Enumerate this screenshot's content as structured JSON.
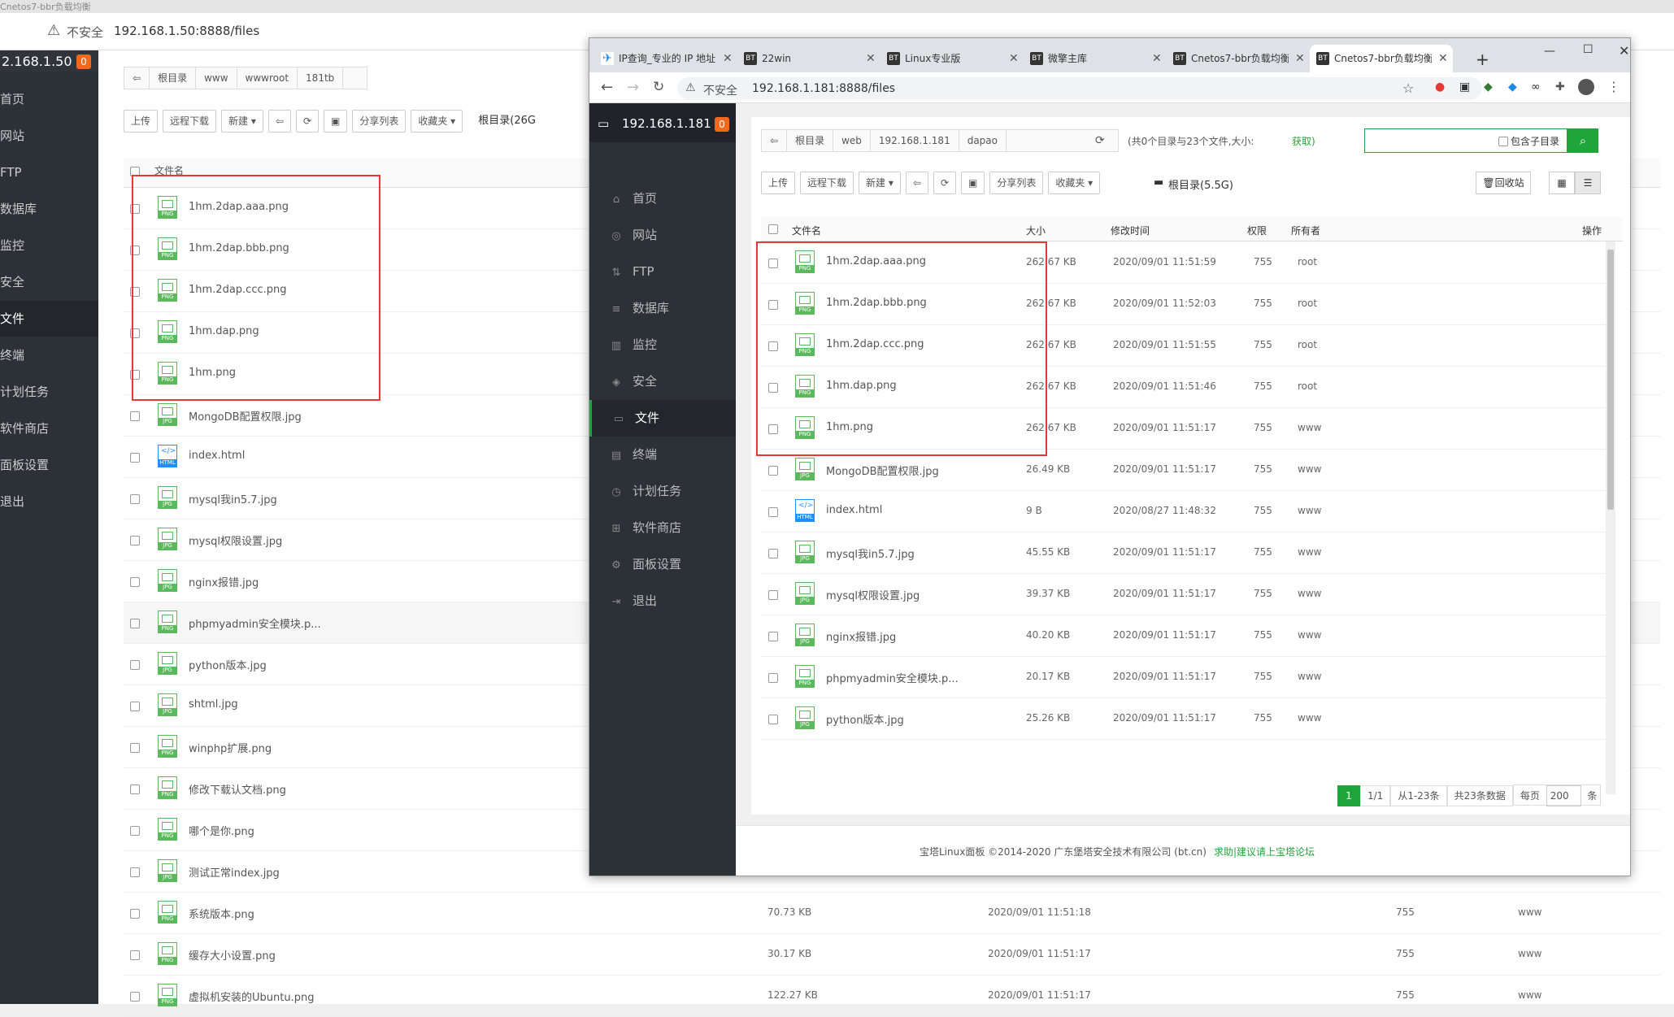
{
  "bg": {
    "title": "Cnetos7-bbr负载均衡",
    "addr_security": "不安全",
    "addr_url": "192.168.1.50:8888/files",
    "host": "2.168.1.50",
    "badge": "0",
    "nav": [
      "首页",
      "网站",
      "FTP",
      "数据库",
      "监控",
      "安全",
      "文件",
      "终端",
      "计划任务",
      "软件商店",
      "面板设置",
      "退出"
    ],
    "crumbs": [
      "根目录",
      "www",
      "wwwroot",
      "181tb"
    ],
    "toolbar": [
      "上传",
      "远程下载",
      "新建 ▾",
      "⇦",
      "⟳",
      "▣",
      "分享列表",
      "收藏夹 ▾"
    ],
    "root_label": "根目录(26G",
    "col_filename": "文件名",
    "files": [
      {
        "name": "1hm.2dap.aaa.png",
        "type": "PNG"
      },
      {
        "name": "1hm.2dap.bbb.png",
        "type": "PNG"
      },
      {
        "name": "1hm.2dap.ccc.png",
        "type": "PNG"
      },
      {
        "name": "1hm.dap.png",
        "type": "PNG"
      },
      {
        "name": "1hm.png",
        "type": "PNG"
      },
      {
        "name": "MongoDB配置权限.jpg",
        "type": "JPG"
      },
      {
        "name": "index.html",
        "type": "HTML"
      },
      {
        "name": "mysql我in5.7.jpg",
        "type": "JPG"
      },
      {
        "name": "mysql权限设置.jpg",
        "type": "JPG"
      },
      {
        "name": "nginx报错.jpg",
        "type": "JPG"
      },
      {
        "name": "phpmyadmin安全模块.p...",
        "type": "PNG"
      },
      {
        "name": "python版本.jpg",
        "type": "JPG"
      },
      {
        "name": "shtml.jpg",
        "type": "JPG"
      },
      {
        "name": "winphp扩展.png",
        "type": "PNG"
      },
      {
        "name": "修改下载认文档.png",
        "type": "PNG"
      },
      {
        "name": "哪个是你.png",
        "type": "PNG"
      },
      {
        "name": "测试正常index.jpg",
        "type": "JPG"
      },
      {
        "name": "系统版本.png",
        "type": "PNG",
        "size": "70.73 KB",
        "time": "2020/09/01 11:51:18",
        "perm": "755",
        "owner": "www"
      },
      {
        "name": "缓存大小设置.png",
        "type": "PNG",
        "size": "30.17 KB",
        "time": "2020/09/01 11:51:17",
        "perm": "755",
        "owner": "www"
      },
      {
        "name": "虚拟机安装的Ubuntu.png",
        "type": "PNG",
        "size": "122.27 KB",
        "time": "2020/09/01 11:51:17",
        "perm": "755",
        "owner": "www"
      }
    ]
  },
  "fw": {
    "tabs": [
      {
        "icon": "IP",
        "label": "IP查询_专业的 IP 地址"
      },
      {
        "icon": "BT",
        "label": "22win"
      },
      {
        "icon": "BT",
        "label": "Linux专业版"
      },
      {
        "icon": "BT",
        "label": "微擎主库"
      },
      {
        "icon": "BT",
        "label": "Cnetos7-bbr负载均衡"
      },
      {
        "icon": "BT",
        "label": "Cnetos7-bbr负载均衡"
      }
    ],
    "new_tab": "+",
    "addr_security": "不安全",
    "addr_url": "192.168.1.181:8888/files",
    "host": "192.168.1.181",
    "badge": "0",
    "nav": [
      {
        "icon": "⌂",
        "label": "首页"
      },
      {
        "icon": "◎",
        "label": "网站"
      },
      {
        "icon": "⇅",
        "label": "FTP"
      },
      {
        "icon": "≡",
        "label": "数据库"
      },
      {
        "icon": "▥",
        "label": "监控"
      },
      {
        "icon": "◈",
        "label": "安全"
      },
      {
        "icon": "▭",
        "label": "文件"
      },
      {
        "icon": "▤",
        "label": "终端"
      },
      {
        "icon": "◷",
        "label": "计划任务"
      },
      {
        "icon": "⊞",
        "label": "软件商店"
      },
      {
        "icon": "⚙",
        "label": "面板设置"
      },
      {
        "icon": "⇥",
        "label": "退出"
      }
    ],
    "crumbs": [
      "根目录",
      "web",
      "192.168.1.181",
      "dapao"
    ],
    "dir_info": "(共0个目录与23个文件,大小:",
    "dir_fetch": "获取)",
    "include_subdir": "包含子目录",
    "toolbar": [
      "上传",
      "远程下载",
      "新建 ▾",
      "⇦",
      "⟳",
      "▣",
      "分享列表",
      "收藏夹 ▾"
    ],
    "root_label": "根目录(5.5G)",
    "recycle": "回收站",
    "columns": [
      "文件名",
      "大小",
      "修改时间",
      "权限",
      "所有者",
      "操作"
    ],
    "files": [
      {
        "name": "1hm.2dap.aaa.png",
        "type": "PNG",
        "size": "262.67 KB",
        "time": "2020/09/01 11:51:59",
        "perm": "755",
        "owner": "root"
      },
      {
        "name": "1hm.2dap.bbb.png",
        "type": "PNG",
        "size": "262.67 KB",
        "time": "2020/09/01 11:52:03",
        "perm": "755",
        "owner": "root"
      },
      {
        "name": "1hm.2dap.ccc.png",
        "type": "PNG",
        "size": "262.67 KB",
        "time": "2020/09/01 11:51:55",
        "perm": "755",
        "owner": "root"
      },
      {
        "name": "1hm.dap.png",
        "type": "PNG",
        "size": "262.67 KB",
        "time": "2020/09/01 11:51:46",
        "perm": "755",
        "owner": "root"
      },
      {
        "name": "1hm.png",
        "type": "PNG",
        "size": "262.67 KB",
        "time": "2020/09/01 11:51:17",
        "perm": "755",
        "owner": "www"
      },
      {
        "name": "MongoDB配置权限.jpg",
        "type": "JPG",
        "size": "26.49 KB",
        "time": "2020/09/01 11:51:17",
        "perm": "755",
        "owner": "www"
      },
      {
        "name": "index.html",
        "type": "HTML",
        "size": "9 B",
        "time": "2020/08/27 11:48:32",
        "perm": "755",
        "owner": "www"
      },
      {
        "name": "mysql我in5.7.jpg",
        "type": "JPG",
        "size": "45.55 KB",
        "time": "2020/09/01 11:51:17",
        "perm": "755",
        "owner": "www"
      },
      {
        "name": "mysql权限设置.jpg",
        "type": "JPG",
        "size": "39.37 KB",
        "time": "2020/09/01 11:51:17",
        "perm": "755",
        "owner": "www"
      },
      {
        "name": "nginx报错.jpg",
        "type": "JPG",
        "size": "40.20 KB",
        "time": "2020/09/01 11:51:17",
        "perm": "755",
        "owner": "www"
      },
      {
        "name": "phpmyadmin安全模块.p...",
        "type": "PNG",
        "size": "20.17 KB",
        "time": "2020/09/01 11:51:17",
        "perm": "755",
        "owner": "www"
      },
      {
        "name": "python版本.jpg",
        "type": "JPG",
        "size": "25.26 KB",
        "time": "2020/09/01 11:51:17",
        "perm": "755",
        "owner": "www"
      }
    ],
    "pagination": {
      "current": "1",
      "pages": "1/1",
      "range": "从1-23条",
      "total": "共23条数据",
      "per_page_label": "每页",
      "per_page": "200",
      "unit": "条"
    },
    "footer_copy": "宝塔Linux面板 ©2014-2020 广东堡塔安全技术有限公司 (bt.cn)",
    "footer_link": "求助|建议请上宝塔论坛",
    "colors": {
      "accent": "#20a53a",
      "badge": "#f0691d",
      "highlight_box": "#e53935"
    }
  }
}
